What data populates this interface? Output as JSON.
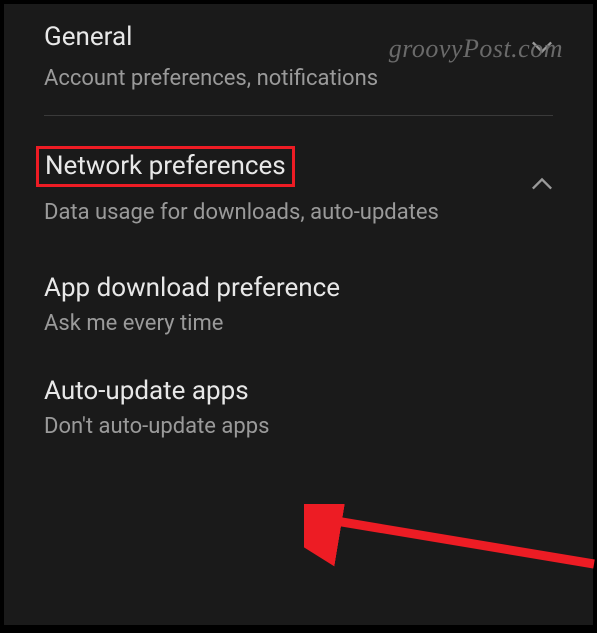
{
  "watermark": "groovyPost.com",
  "sections": {
    "general": {
      "title": "General",
      "subtitle": "Account preferences, notifications"
    },
    "network": {
      "title": "Network preferences",
      "subtitle": "Data usage for downloads, auto-updates"
    }
  },
  "subitems": {
    "download": {
      "title": "App download preference",
      "subtitle": "Ask me every time"
    },
    "autoupdate": {
      "title": "Auto-update apps",
      "subtitle": "Don't auto-update apps"
    }
  },
  "colors": {
    "highlight": "#ed1c24",
    "arrow": "#ed1c24"
  }
}
